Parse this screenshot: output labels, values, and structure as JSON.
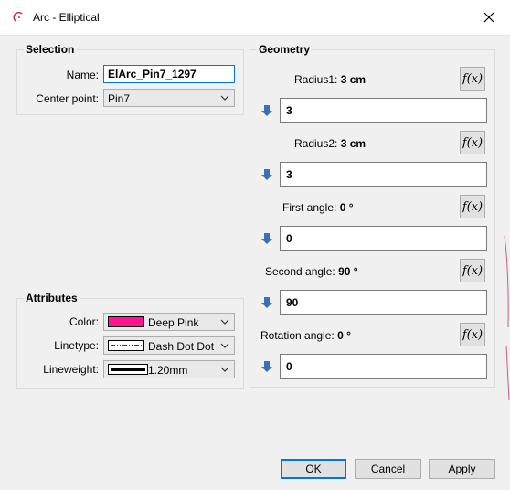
{
  "window": {
    "title": "Arc - Elliptical",
    "close_glyph": "✕"
  },
  "selection": {
    "title": "Selection",
    "name_label": "Name:",
    "name_value": "ElArc_Pin7_1297",
    "center_label": "Center point:",
    "center_value": "Pin7"
  },
  "attributes": {
    "title": "Attributes",
    "color_label": "Color:",
    "color_value": "Deep Pink",
    "color_hex": "#ff1493",
    "linetype_label": "Linetype:",
    "linetype_value": "Dash Dot Dot",
    "lineweight_label": "Lineweight:",
    "lineweight_value": "1.20mm"
  },
  "geometry": {
    "title": "Geometry",
    "fx_label": "f(x)",
    "rows": [
      {
        "label": "Radius1:",
        "current": "3 cm",
        "input": "3"
      },
      {
        "label": "Radius2:",
        "current": "3 cm",
        "input": "3"
      },
      {
        "label": "First angle:",
        "current": "0 °",
        "input": "0"
      },
      {
        "label": "Second angle:",
        "current": "90 °",
        "input": "90"
      },
      {
        "label": "Rotation angle:",
        "current": "0 °",
        "input": "0"
      }
    ]
  },
  "buttons": {
    "ok": "OK",
    "cancel": "Cancel",
    "apply": "Apply"
  },
  "icons": {
    "app": "arc-icon",
    "close": "close-icon",
    "dropdown": "chevron-down-icon",
    "arrow": "arrow-down-icon",
    "fx": "function-icon"
  },
  "colors": {
    "accent": "#0078d7",
    "arrow": "#3b6fb6"
  }
}
